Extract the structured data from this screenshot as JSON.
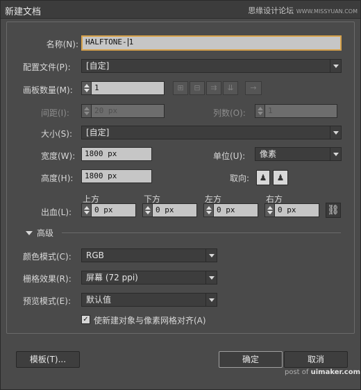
{
  "window": {
    "title": "新建文档",
    "watermark": "思缘设计论坛",
    "watermark_url": "WWW.MISSYUAN.COM"
  },
  "name": {
    "label": "名称(N):",
    "value_before_caret": "HALFTONE-",
    "value_after_caret": "1"
  },
  "profile": {
    "label": "配置文件(P):",
    "value": "[自定]"
  },
  "artboards": {
    "label": "画板数量(M):",
    "value": "1",
    "arrow": "→"
  },
  "spacing": {
    "label": "间距(I):",
    "value": "20 px"
  },
  "columns": {
    "label": "列数(O):",
    "value": "1"
  },
  "size": {
    "label": "大小(S):",
    "value": "[自定]"
  },
  "width": {
    "label": "宽度(W):",
    "value": "1800 px"
  },
  "units": {
    "label": "单位(U):",
    "value": "像素"
  },
  "height": {
    "label": "高度(H):",
    "value": "1800 px"
  },
  "orientation": {
    "label": "取向:"
  },
  "bleed": {
    "label": "出血(L):",
    "top_label": "上方",
    "bottom_label": "下方",
    "left_label": "左方",
    "right_label": "右方",
    "top": "0 px",
    "bottom": "0 px",
    "left": "0 px",
    "right": "0 px"
  },
  "advanced": {
    "label": "高级"
  },
  "color_mode": {
    "label": "颜色模式(C):",
    "value": "RGB"
  },
  "raster": {
    "label": "栅格效果(R):",
    "value": "屏幕 (72 ppi)"
  },
  "preview": {
    "label": "预览模式(E):",
    "value": "默认值"
  },
  "align": {
    "checked": true,
    "label": "使新建对象与像素网格对齐(A)"
  },
  "buttons": {
    "template": "模板(T)...",
    "ok": "确定",
    "cancel": "取消"
  },
  "footer": {
    "post_prefix": "post of",
    "post_site": "uimaker.com"
  }
}
